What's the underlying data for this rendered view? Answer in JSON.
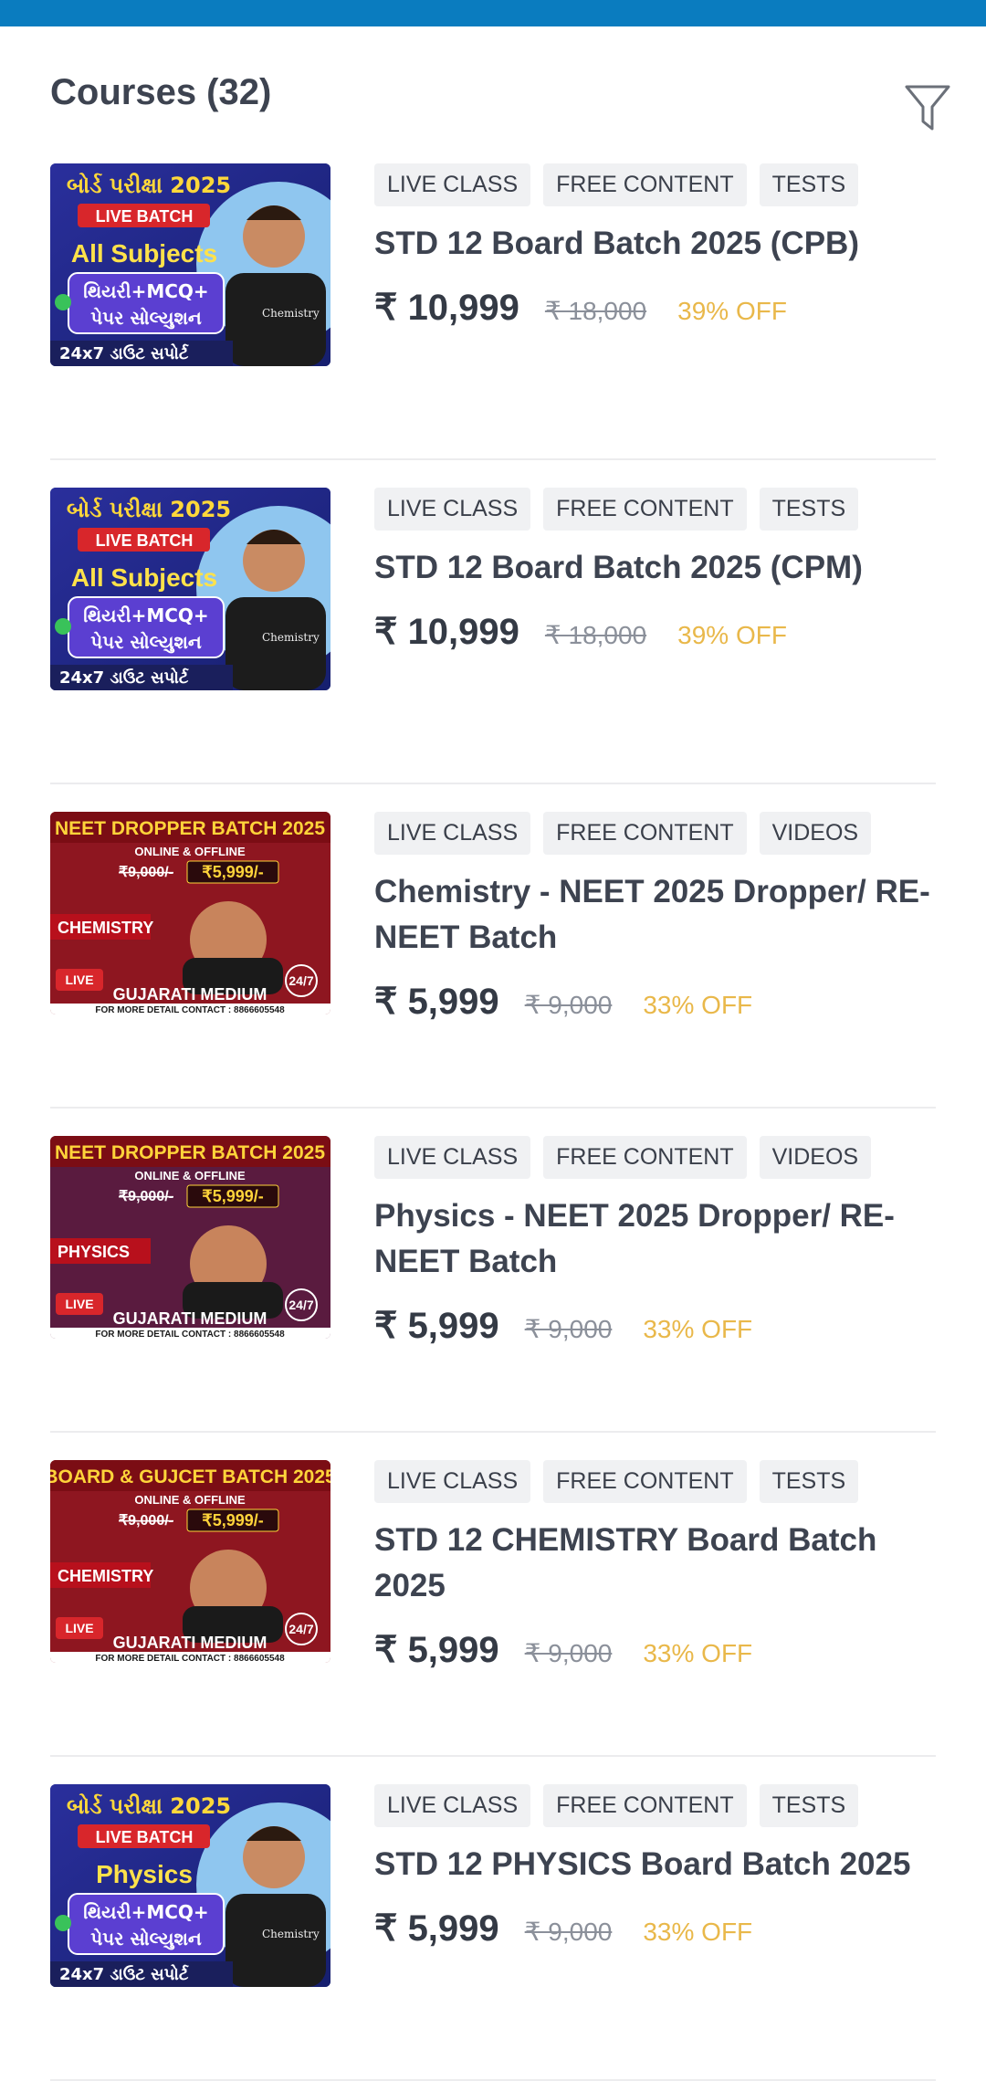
{
  "header": {
    "title": "Courses (32)",
    "filter_icon": "filter-icon"
  },
  "courses": [
    {
      "thumb": {
        "style": "board",
        "line1": "બોર્ડ પરીક્ષા 2025",
        "line2": "LIVE BATCH",
        "line3": "All Subjects",
        "line4": "થિયરી+MCQ+",
        "line5": "પેપર સોલ્યુશન",
        "line6": "24x7 ડાઉટ સપોર્ટ",
        "shirt": "Chemistry"
      },
      "tags": [
        "LIVE CLASS",
        "FREE CONTENT",
        "TESTS"
      ],
      "name": "STD 12 Board Batch 2025 (CPB)",
      "price": "₹ 10,999",
      "old_price": "₹ 18,000",
      "discount": "39% OFF"
    },
    {
      "thumb": {
        "style": "board",
        "line1": "બોર્ડ પરીક્ષા 2025",
        "line2": "LIVE BATCH",
        "line3": "All Subjects",
        "line4": "થિયરી+MCQ+",
        "line5": "પેપર સોલ્યુશન",
        "line6": "24x7 ડાઉટ સપોર્ટ",
        "shirt": "Chemistry"
      },
      "tags": [
        "LIVE CLASS",
        "FREE CONTENT",
        "TESTS"
      ],
      "name": "STD 12 Board Batch 2025 (CPM)",
      "price": "₹ 10,999",
      "old_price": "₹ 18,000",
      "discount": "39% OFF"
    },
    {
      "thumb": {
        "style": "neet",
        "line1": "NEET DROPPER BATCH 2025",
        "line2": "ONLINE & OFFLINE",
        "line3": "₹9,000/-",
        "line4": "₹5,999/-",
        "line5": "CHEMISTRY",
        "line6": "GUJARATI MEDIUM",
        "line7": "FOR MORE DETAIL CONTACT : 8866605548"
      },
      "tags": [
        "LIVE CLASS",
        "FREE CONTENT",
        "VIDEOS"
      ],
      "name": "Chemistry - NEET 2025 Dropper/ RE-NEET Batch",
      "price": "₹ 5,999",
      "old_price": "₹ 9,000",
      "discount": "33% OFF"
    },
    {
      "thumb": {
        "style": "neet-purple",
        "line1": "NEET DROPPER BATCH 2025",
        "line2": "ONLINE & OFFLINE",
        "line3": "₹9,000/-",
        "line4": "₹5,999/-",
        "line5": "PHYSICS",
        "line6": "GUJARATI MEDIUM",
        "line7": "FOR MORE DETAIL CONTACT : 8866605548"
      },
      "tags": [
        "LIVE CLASS",
        "FREE CONTENT",
        "VIDEOS"
      ],
      "name": "Physics - NEET 2025 Dropper/ RE-NEET Batch",
      "price": "₹ 5,999",
      "old_price": "₹ 9,000",
      "discount": "33% OFF"
    },
    {
      "thumb": {
        "style": "neet",
        "line1": "BOARD & GUJCET BATCH 2025",
        "line2": "ONLINE & OFFLINE",
        "line3": "₹9,000/-",
        "line4": "₹5,999/-",
        "line5": "CHEMISTRY",
        "line6": "GUJARATI MEDIUM",
        "line7": "FOR MORE DETAIL CONTACT : 8866605548"
      },
      "tags": [
        "LIVE CLASS",
        "FREE CONTENT",
        "TESTS"
      ],
      "name": "STD 12 CHEMISTRY Board Batch 2025",
      "price": "₹ 5,999",
      "old_price": "₹ 9,000",
      "discount": "33% OFF"
    },
    {
      "thumb": {
        "style": "board",
        "line1": "બોર્ડ પરીક્ષા 2025",
        "line2": "LIVE BATCH",
        "line3": "Physics",
        "line4": "થિયરી+MCQ+",
        "line5": "પેપર સોલ્યુશન",
        "line6": "24x7 ડાઉટ સપોર્ટ",
        "shirt": "Chemistry"
      },
      "tags": [
        "LIVE CLASS",
        "FREE CONTENT",
        "TESTS"
      ],
      "name": "STD 12 PHYSICS Board Batch 2025",
      "price": "₹ 5,999",
      "old_price": "₹ 9,000",
      "discount": "33% OFF"
    }
  ],
  "colors": {
    "topbar": "#0a7cbf",
    "discount": "#e9b84a",
    "tag_bg": "#f0f1f3"
  }
}
